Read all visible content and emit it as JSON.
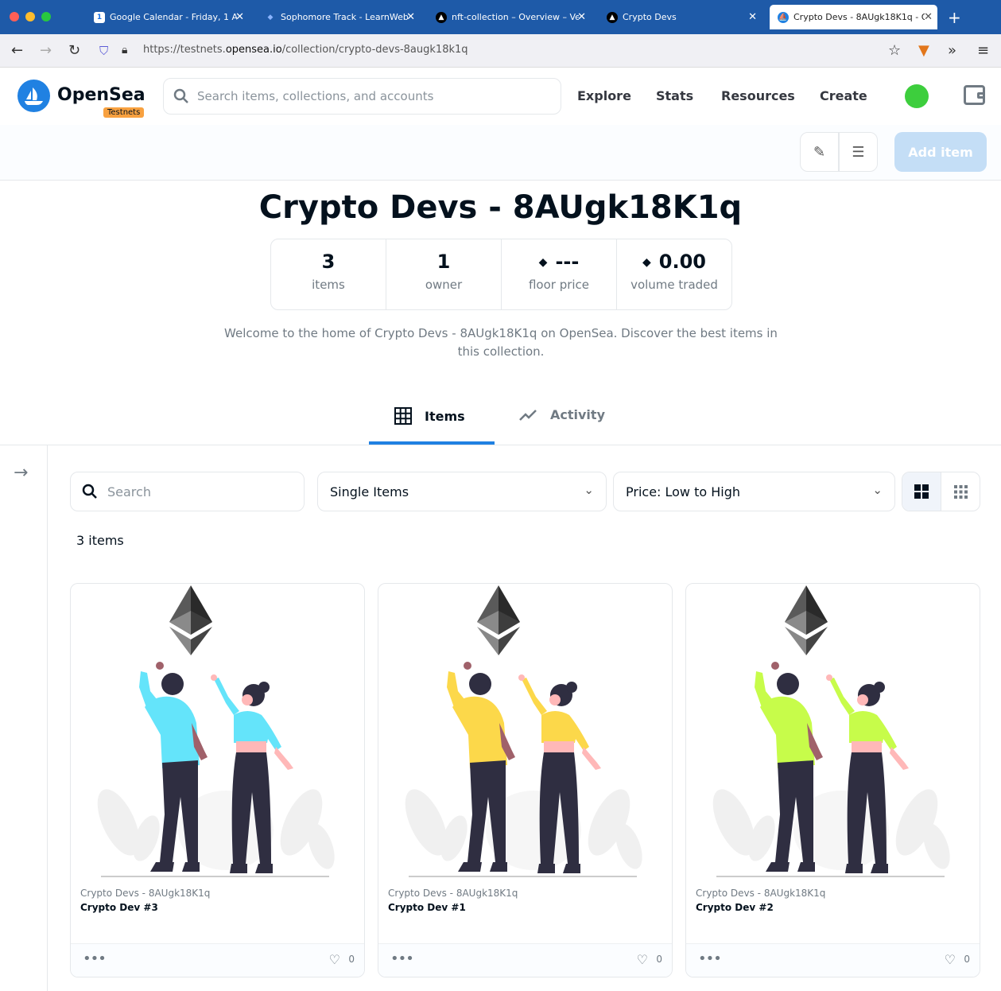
{
  "browser": {
    "tabs": [
      {
        "title": "Google Calendar - Friday, 1 Ap"
      },
      {
        "title": "Sophomore Track - LearnWeb3"
      },
      {
        "title": "nft-collection – Overview – Ve"
      },
      {
        "title": "Crypto Devs"
      },
      {
        "title": "Crypto Devs - 8AUgk18K1q - O"
      }
    ],
    "url_prefix": "https://testnets.",
    "url_domain": "opensea.io",
    "url_path": "/collection/crypto-devs-8augk18k1q"
  },
  "header": {
    "logo": "OpenSea",
    "badge": "Testnets",
    "search_placeholder": "Search items, collections, and accounts",
    "nav": [
      "Explore",
      "Stats",
      "Resources",
      "Create"
    ]
  },
  "manage": {
    "add_item_label": "Add item"
  },
  "collection": {
    "title": "Crypto Devs - 8AUgk18K1q",
    "stats": [
      {
        "value": "3",
        "label": "items",
        "eth": false
      },
      {
        "value": "1",
        "label": "owner",
        "eth": false
      },
      {
        "value": "---",
        "label": "floor price",
        "eth": true
      },
      {
        "value": "0.00",
        "label": "volume traded",
        "eth": true
      }
    ],
    "description": "Welcome to the home of Crypto Devs - 8AUgk18K1q on OpenSea. Discover the best items in this collection."
  },
  "tabs": {
    "items": "Items",
    "activity": "Activity"
  },
  "filters": {
    "search_placeholder": "Search",
    "type_select": "Single Items",
    "sort_select": "Price: Low to High"
  },
  "results": {
    "count_label": "3 items"
  },
  "cards": [
    {
      "collection": "Crypto Devs - 8AUgk18K1q",
      "name": "Crypto Dev #3",
      "likes": "0",
      "color": "#64e4fa"
    },
    {
      "collection": "Crypto Devs - 8AUgk18K1q",
      "name": "Crypto Dev #1",
      "likes": "0",
      "color": "#fcd84a"
    },
    {
      "collection": "Crypto Devs - 8AUgk18K1q",
      "name": "Crypto Dev #2",
      "likes": "0",
      "color": "#c7fc4a"
    }
  ],
  "colors": {
    "accent": "#2081e2",
    "tabbar": "#1e5aa8",
    "badge": "#f8a140",
    "add_item_disabled": "#c4def6"
  }
}
